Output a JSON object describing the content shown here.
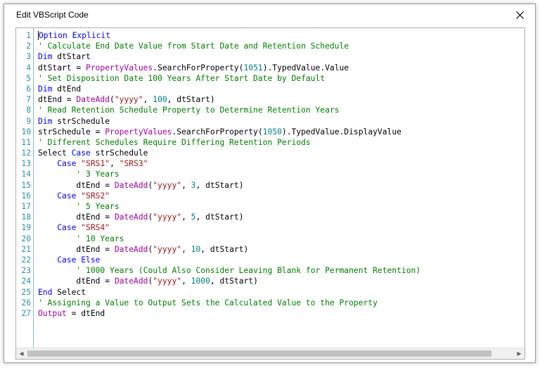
{
  "window": {
    "title": "Edit VBScript Code",
    "close_icon": "close-icon"
  },
  "editor": {
    "line_numbers": [
      "1",
      "2",
      "3",
      "4",
      "5",
      "6",
      "7",
      "8",
      "9",
      "10",
      "11",
      "12",
      "13",
      "14",
      "15",
      "16",
      "17",
      "18",
      "19",
      "20",
      "21",
      "22",
      "23",
      "24",
      "25",
      "26",
      "27"
    ],
    "lines": [
      [
        [
          "kw",
          "Option Explicit"
        ]
      ],
      [
        [
          "cm",
          "' Calculate End Date Value from Start Date and Retention Schedule"
        ]
      ],
      [
        [
          "kw",
          "Dim"
        ],
        [
          "pl",
          " dtStart"
        ]
      ],
      [
        [
          "pl",
          "dtStart = "
        ],
        [
          "fn",
          "PropertyValues"
        ],
        [
          "pl",
          ".SearchForProperty("
        ],
        [
          "nm",
          "1051"
        ],
        [
          "pl",
          ").TypedValue.Value"
        ]
      ],
      [
        [
          "cm",
          "' Set Disposition Date 100 Years After Start Date by Default"
        ]
      ],
      [
        [
          "kw",
          "Dim"
        ],
        [
          "pl",
          " dtEnd"
        ]
      ],
      [
        [
          "pl",
          "dtEnd = "
        ],
        [
          "fn",
          "DateAdd"
        ],
        [
          "pl",
          "("
        ],
        [
          "st",
          "\"yyyy\""
        ],
        [
          "pl",
          ", "
        ],
        [
          "nm",
          "100"
        ],
        [
          "pl",
          ", dtStart)"
        ]
      ],
      [
        [
          "cm",
          "' Read Retention Schedule Property to Determine Retention Years"
        ]
      ],
      [
        [
          "kw",
          "Dim"
        ],
        [
          "pl",
          " strSchedule"
        ]
      ],
      [
        [
          "pl",
          "strSchedule = "
        ],
        [
          "fn",
          "PropertyValues"
        ],
        [
          "pl",
          ".SearchForProperty("
        ],
        [
          "nm",
          "1050"
        ],
        [
          "pl",
          ").TypedValue.DisplayValue"
        ]
      ],
      [
        [
          "cm",
          "' Different Schedules Require Differing Retention Periods"
        ]
      ],
      [
        [
          "pl",
          "Select "
        ],
        [
          "kw",
          "Case"
        ],
        [
          "pl",
          " strSchedule"
        ]
      ],
      [
        [
          "pl",
          "    "
        ],
        [
          "kw",
          "Case"
        ],
        [
          "pl",
          " "
        ],
        [
          "st",
          "\"SRS1\""
        ],
        [
          "pl",
          ", "
        ],
        [
          "st",
          "\"SRS3\""
        ]
      ],
      [
        [
          "pl",
          "        "
        ],
        [
          "cm",
          "' 3 Years"
        ]
      ],
      [
        [
          "pl",
          "        dtEnd = "
        ],
        [
          "fn",
          "DateAdd"
        ],
        [
          "pl",
          "("
        ],
        [
          "st",
          "\"yyyy\""
        ],
        [
          "pl",
          ", "
        ],
        [
          "nm",
          "3"
        ],
        [
          "pl",
          ", dtStart)"
        ]
      ],
      [
        [
          "pl",
          "    "
        ],
        [
          "kw",
          "Case"
        ],
        [
          "pl",
          " "
        ],
        [
          "st",
          "\"SRS2\""
        ]
      ],
      [
        [
          "pl",
          "        "
        ],
        [
          "cm",
          "' 5 Years"
        ]
      ],
      [
        [
          "pl",
          "        dtEnd = "
        ],
        [
          "fn",
          "DateAdd"
        ],
        [
          "pl",
          "("
        ],
        [
          "st",
          "\"yyyy\""
        ],
        [
          "pl",
          ", "
        ],
        [
          "nm",
          "5"
        ],
        [
          "pl",
          ", dtStart)"
        ]
      ],
      [
        [
          "pl",
          "    "
        ],
        [
          "kw",
          "Case"
        ],
        [
          "pl",
          " "
        ],
        [
          "st",
          "\"SRS4\""
        ]
      ],
      [
        [
          "pl",
          "        "
        ],
        [
          "cm",
          "' 10 Years"
        ]
      ],
      [
        [
          "pl",
          "        dtEnd = "
        ],
        [
          "fn",
          "DateAdd"
        ],
        [
          "pl",
          "("
        ],
        [
          "st",
          "\"yyyy\""
        ],
        [
          "pl",
          ", "
        ],
        [
          "nm",
          "10"
        ],
        [
          "pl",
          ", dtStart)"
        ]
      ],
      [
        [
          "pl",
          "    "
        ],
        [
          "kw",
          "Case Else"
        ]
      ],
      [
        [
          "pl",
          "        "
        ],
        [
          "cm",
          "' 1000 Years (Could Also Consider Leaving Blank for Permanent Retention)"
        ]
      ],
      [
        [
          "pl",
          "        dtEnd = "
        ],
        [
          "fn",
          "DateAdd"
        ],
        [
          "pl",
          "("
        ],
        [
          "st",
          "\"yyyy\""
        ],
        [
          "pl",
          ", "
        ],
        [
          "nm",
          "1000"
        ],
        [
          "pl",
          ", dtStart)"
        ]
      ],
      [
        [
          "kw",
          "End"
        ],
        [
          "pl",
          " Select"
        ]
      ],
      [
        [
          "cm",
          "' Assigning a Value to Output Sets the Calculated Value to the Property"
        ]
      ],
      [
        [
          "fn",
          "Output"
        ],
        [
          "pl",
          " = dtEnd"
        ]
      ]
    ]
  },
  "colors": {
    "keyword": "#0000ff",
    "comment": "#008000",
    "string": "#a31515",
    "object": "#a000a0",
    "number": "#008080",
    "line_number": "#2b91af"
  }
}
